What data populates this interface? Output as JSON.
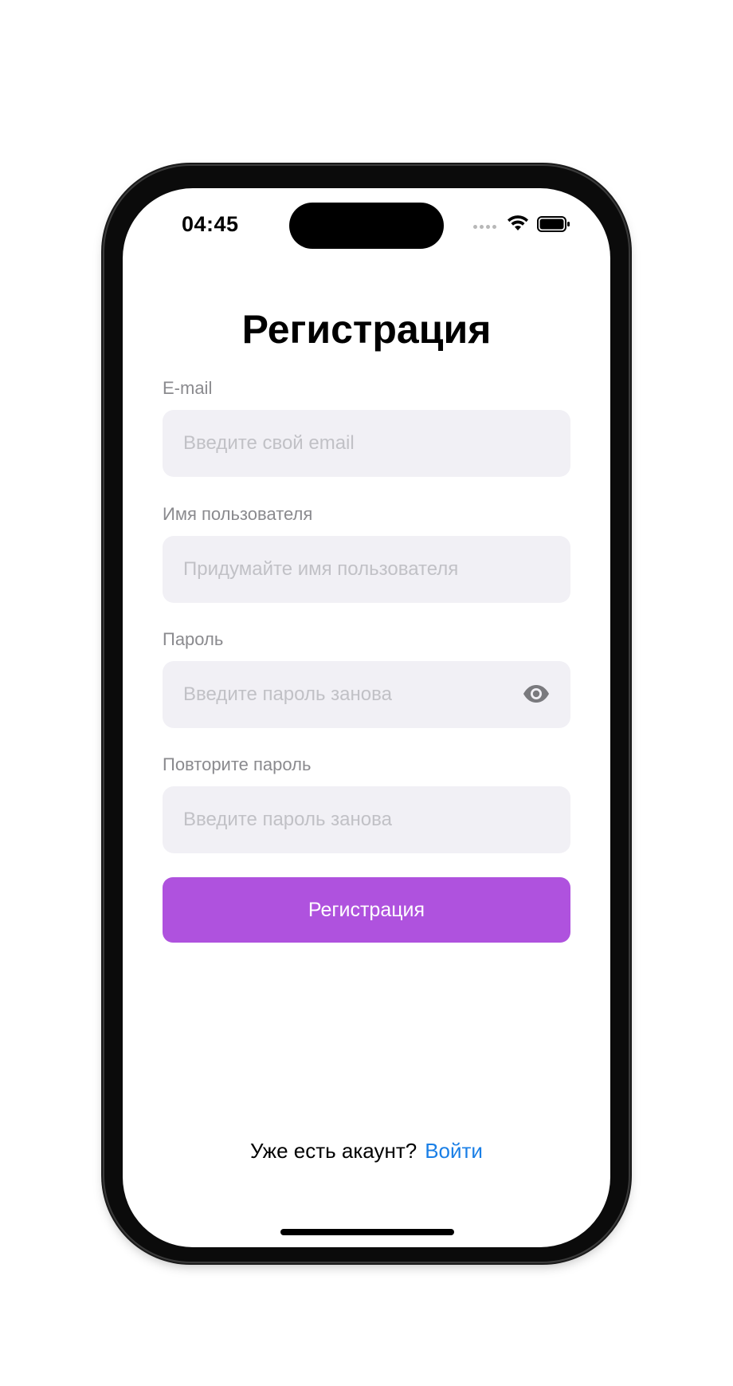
{
  "status_bar": {
    "time": "04:45"
  },
  "screen": {
    "title": "Регистрация"
  },
  "form": {
    "email": {
      "label": "E-mail",
      "value": "",
      "placeholder": "Введите свой email"
    },
    "username": {
      "label": "Имя пользователя",
      "value": "",
      "placeholder": "Придумайте имя пользователя"
    },
    "password": {
      "label": "Пароль",
      "value": "",
      "placeholder": "Введите пароль занова",
      "toggle_icon": "eye-icon"
    },
    "repeat_password": {
      "label": "Повторите пароль",
      "value": "",
      "placeholder": "Введите пароль занова"
    },
    "submit_label": "Регистрация"
  },
  "footer": {
    "prompt": "Уже есть акаунт?",
    "login_link": "Войти"
  },
  "colors": {
    "accent": "#af52de",
    "link": "#1a7fe6",
    "field_background": "#f1f0f5",
    "label": "#8a8a8e",
    "placeholder": "#c1c1c6"
  }
}
